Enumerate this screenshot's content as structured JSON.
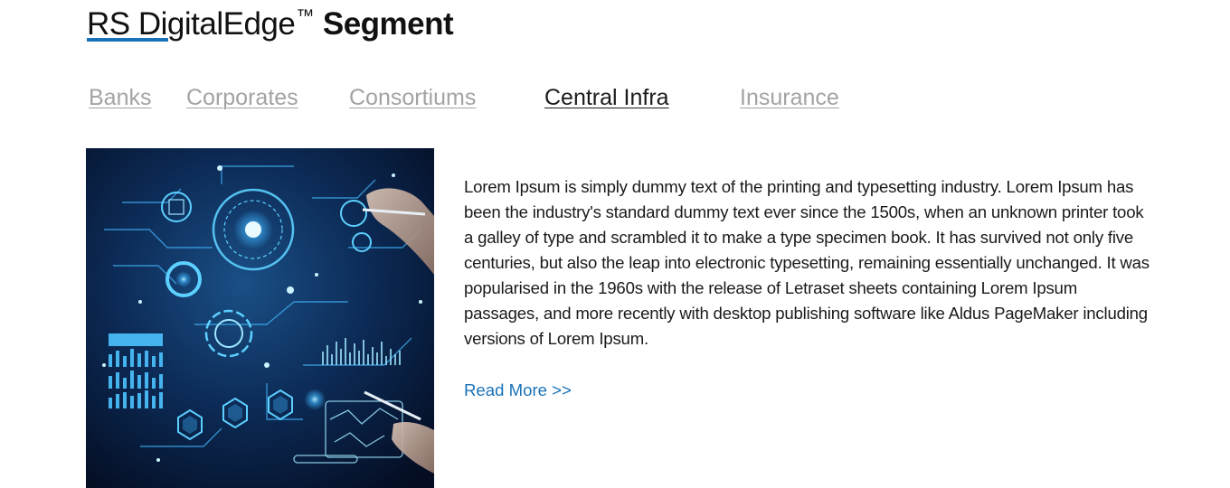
{
  "header": {
    "title_regular": "RS DigitalEdge",
    "trademark": "™",
    "title_bold": "Segment",
    "accent_color": "#1a73b8"
  },
  "tabs": [
    {
      "label": "Banks",
      "active": false
    },
    {
      "label": "Corporates",
      "active": false
    },
    {
      "label": "Consortiums",
      "active": false
    },
    {
      "label": "Central Infra",
      "active": true
    },
    {
      "label": "Insurance",
      "active": false
    }
  ],
  "content": {
    "image_icon": "digital-technology-hud-image",
    "paragraph": "Lorem Ipsum is simply dummy text of the printing and typesetting industry. Lorem Ipsum has been the industry's standard dummy text ever since the 1500s, when an unknown printer took a galley of type and scrambled it to make a type specimen book. It has survived not only five centuries, but also the leap into electronic typesetting, remaining essentially unchanged. It was popularised in the 1960s with the release of Letraset sheets containing Lorem Ipsum passages, and more recently with desktop publishing software like Aldus PageMaker including versions of Lorem Ipsum.",
    "read_more_label": "Read More >>"
  }
}
